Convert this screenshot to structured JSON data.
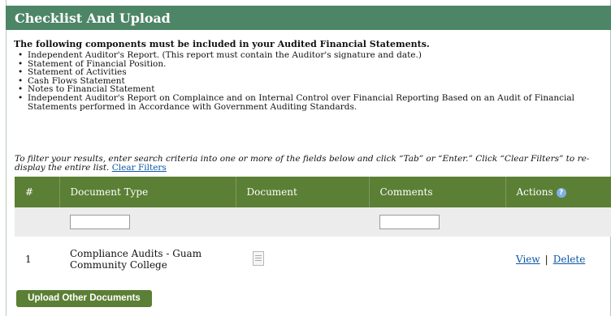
{
  "header": {
    "title": "Checklist And Upload"
  },
  "intro": "The following components must be included in your Audited Financial Statements.",
  "requirements": [
    "Independent Auditor's Report. (This report must contain the Auditor's signature and date.)",
    "Statement of Financial Position.",
    "Statement of Activities",
    "Cash Flows Statement",
    "Notes to Financial Statement",
    "Independent Auditor's Report on Complaince and on Internal Control over Financial Reporting Based on an Audit of Financial Statements performed in Accordance with Government Auditing Standards."
  ],
  "filter_note": "To filter your results, enter search criteria into one or more of the fields below and click “Tab” or “Enter.” Click “Clear Filters” to re-display the entire list.",
  "clear_filters": "Clear Filters",
  "table": {
    "columns": [
      "#",
      "Document Type",
      "Document",
      "Comments",
      "Actions"
    ],
    "rows": [
      {
        "num": "1",
        "document_type": "Compliance Audits - Guam Community College",
        "actions": {
          "view": "View",
          "separator": "|",
          "delete": "Delete"
        }
      }
    ]
  },
  "icons": {
    "help": "help-icon",
    "document": "document-icon"
  },
  "help_glyph": "?",
  "upload_button": "Upload Other Documents",
  "colors": {
    "header": "#4d8567",
    "table_header": "#5b7f35",
    "link": "#0b56a3"
  }
}
